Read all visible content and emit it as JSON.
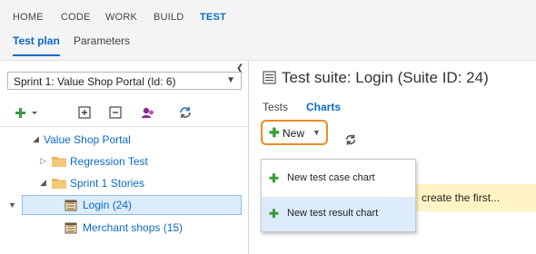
{
  "topnav": {
    "items": [
      {
        "label": "HOME"
      },
      {
        "label": "CODE"
      },
      {
        "label": "WORK"
      },
      {
        "label": "BUILD"
      },
      {
        "label": "TEST"
      }
    ],
    "subtabs": [
      {
        "label": "Test plan"
      },
      {
        "label": "Parameters"
      }
    ]
  },
  "left": {
    "plan_select": "Sprint 1: Value Shop Portal (Id: 6)",
    "tree": [
      {
        "label": "Value Shop Portal"
      },
      {
        "label": "Regression Test"
      },
      {
        "label": "Sprint 1 Stories"
      },
      {
        "label": "Login (24)"
      },
      {
        "label": "Merchant shops (15)"
      }
    ]
  },
  "right": {
    "suite_title": "Test suite: Login (Suite ID: 24)",
    "tabs": [
      {
        "label": "Tests"
      },
      {
        "label": "Charts"
      }
    ],
    "new_label": "New",
    "banner_text": "create the first...",
    "menu": [
      {
        "label": "New test case chart"
      },
      {
        "label": "New test result chart"
      }
    ]
  },
  "colors": {
    "accent": "#0a6ac8",
    "highlight_border": "#f08a24",
    "selection": "#dcecfb",
    "banner": "#fff4c4",
    "add_green": "#3a9b3a"
  },
  "icons": [
    "plus-icon",
    "add-suite-icon",
    "remove-icon",
    "assign-testers-icon",
    "sync-icon",
    "folder-icon",
    "suite-icon",
    "refresh-icon",
    "chevron-down-icon",
    "collapse-left-icon",
    "test-suite-header-icon"
  ]
}
